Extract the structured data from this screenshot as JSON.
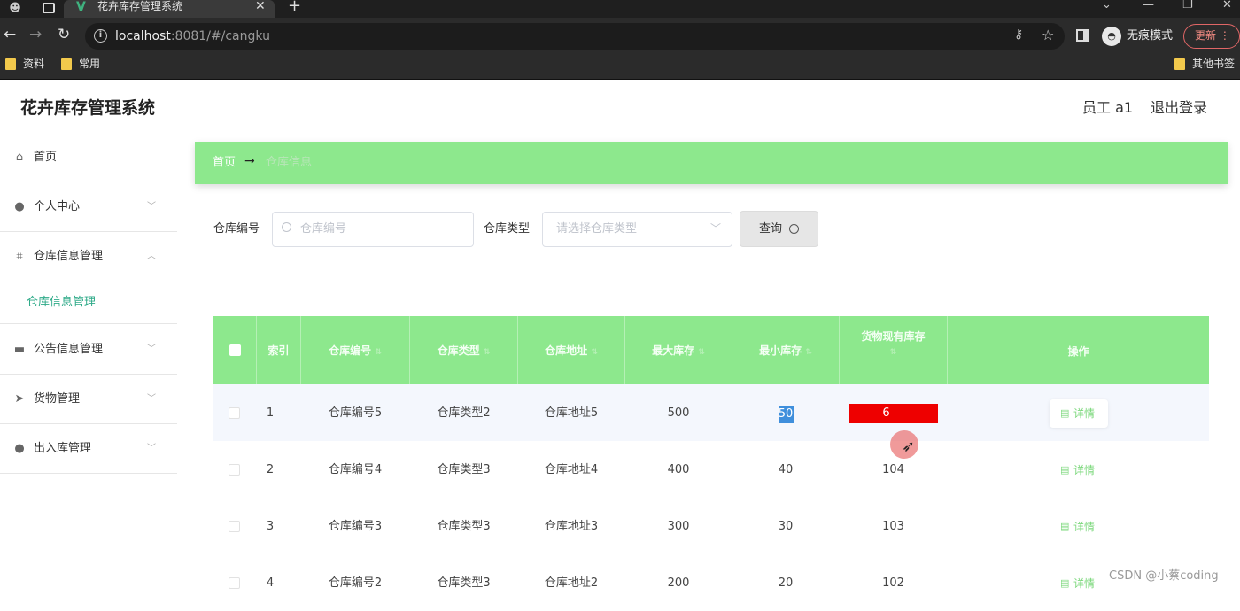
{
  "browser": {
    "tab_title": "花卉库存管理系统",
    "url_host": "localhost",
    "url_rest": ":8081/#/cangku",
    "incognito_label": "无痕模式",
    "update_label": "更新",
    "bookmarks": [
      "资料",
      "常用"
    ],
    "other_bookmarks": "其他书签"
  },
  "app": {
    "title": "花卉库存管理系统",
    "user": "员工 a1",
    "logout": "退出登录"
  },
  "sidebar": {
    "items": [
      {
        "label": "首页",
        "icon": "home-icon"
      },
      {
        "label": "个人中心",
        "icon": "user-icon"
      },
      {
        "label": "仓库信息管理",
        "icon": "crop-icon"
      },
      {
        "label": "公告信息管理",
        "icon": "stack-icon"
      },
      {
        "label": "货物管理",
        "icon": "send-icon"
      },
      {
        "label": "出入库管理",
        "icon": "user-icon"
      }
    ],
    "subitem": "仓库信息管理"
  },
  "breadcrumb": {
    "home": "首页",
    "current": "仓库信息"
  },
  "search": {
    "code_label": "仓库编号",
    "code_placeholder": "仓库编号",
    "type_label": "仓库类型",
    "type_placeholder": "请选择仓库类型",
    "query_label": "查询"
  },
  "table": {
    "headers": {
      "index": "索引",
      "code": "仓库编号",
      "type": "仓库类型",
      "address": "仓库地址",
      "max": "最大库存",
      "min": "最小库存",
      "current_line1": "货物现有库存",
      "action": "操作"
    },
    "rows": [
      {
        "index": "1",
        "code": "仓库编号5",
        "type": "仓库类型2",
        "address": "仓库地址5",
        "max": "500",
        "min": "50",
        "current": "6",
        "action": "详情"
      },
      {
        "index": "2",
        "code": "仓库编号4",
        "type": "仓库类型3",
        "address": "仓库地址4",
        "max": "400",
        "min": "40",
        "current": "104",
        "action": "详情"
      },
      {
        "index": "3",
        "code": "仓库编号3",
        "type": "仓库类型3",
        "address": "仓库地址3",
        "max": "300",
        "min": "30",
        "current": "103",
        "action": "详情"
      },
      {
        "index": "4",
        "code": "仓库编号2",
        "type": "仓库类型3",
        "address": "仓库地址2",
        "max": "200",
        "min": "20",
        "current": "102",
        "action": "详情"
      }
    ]
  },
  "colors": {
    "accent_green": "#8de88d",
    "alert_red": "#ee0000",
    "selection_blue": "#3f8fdc"
  },
  "watermark": "CSDN @小蔡coding"
}
